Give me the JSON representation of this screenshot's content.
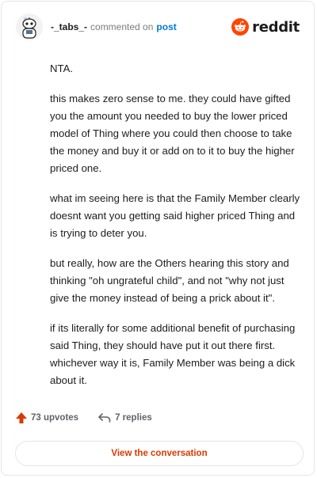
{
  "header": {
    "username": "-_tabs_-",
    "action_text": "commented on",
    "post_link": "post",
    "avatar_icon": "snoo-avatar-icon"
  },
  "brand": {
    "wordmark": "reddit",
    "icon": "reddit-logo-icon",
    "color": "#ff4500"
  },
  "comment": {
    "paragraphs": [
      "NTA.",
      "this makes zero sense to me. they could have gifted you the amount you needed to buy the lower priced model of Thing where you could then choose to take the money and buy it or add on to it to buy the higher priced one.",
      "what im seeing here is that the Family Member clearly doesnt want you getting said higher priced Thing and is trying to deter you.",
      "but really, how are the Others hearing this story and thinking \"oh ungrateful child\", and not \"why not just give the money instead of being a prick about it\".",
      "if its literally for some additional benefit of purchasing said Thing, they should have put it out there first. whichever way it is, Family Member was being a dick about it."
    ]
  },
  "stats": {
    "upvotes": "73 upvotes",
    "upvote_icon": "upvote-arrow-icon",
    "replies": "7 replies",
    "reply_icon": "reply-arrow-icon",
    "upvote_color": "#d93a00"
  },
  "cta": {
    "label": "View the conversation",
    "color": "#d93a00"
  }
}
